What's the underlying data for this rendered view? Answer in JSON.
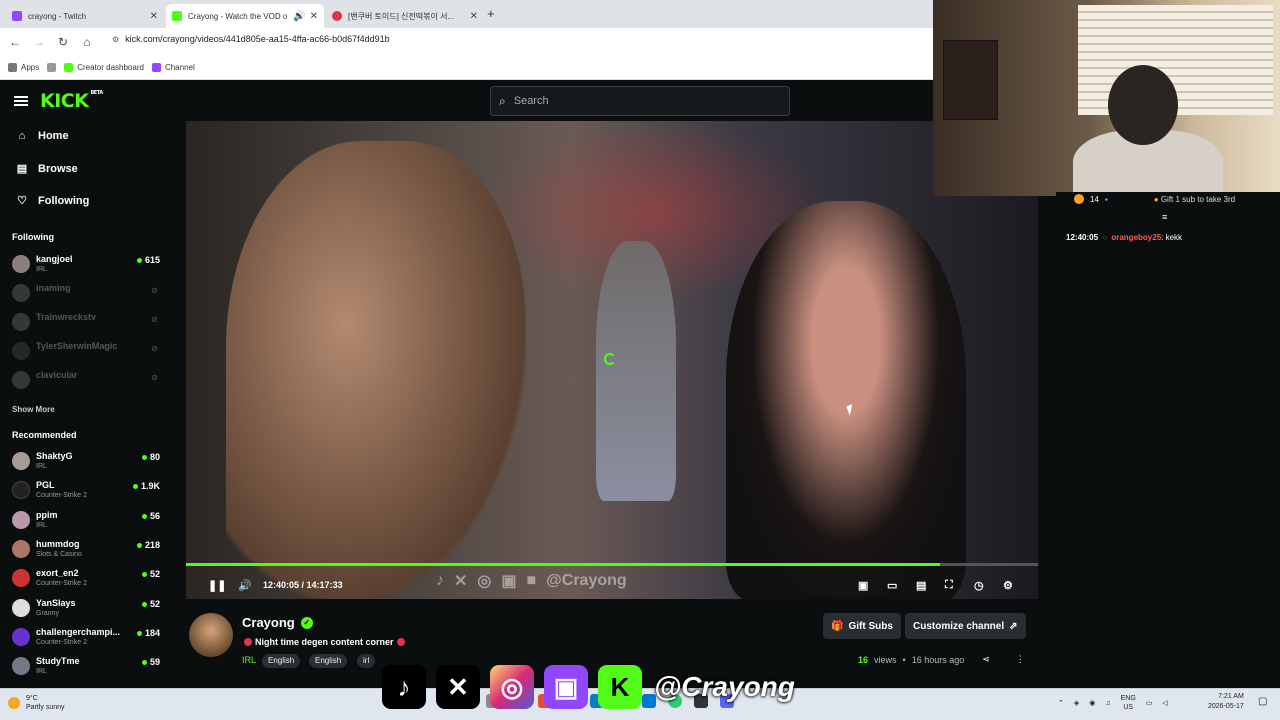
{
  "browser": {
    "tabs": [
      {
        "title": "crayong - Twitch",
        "color": "#9146ff",
        "active": false
      },
      {
        "title": "Crayong - Watch the VOD o",
        "color": "#53fc18",
        "active": true
      },
      {
        "title": "[밴쿠버 토이드] 신전떡볶이 서...",
        "color": "#e0344a",
        "active": false
      }
    ],
    "url": "kick.com/crayong/videos/441d805e-aa15-4ffa-ac66-b0d67f4dd91b",
    "bookmarks": [
      "Apps",
      "Creator dashboard",
      "Channel"
    ]
  },
  "kick": {
    "logo": "KICK",
    "logo_beta": "BETA",
    "search_placeholder": "Search",
    "nav": [
      {
        "label": "Home",
        "icon": "home-icon"
      },
      {
        "label": "Browse",
        "icon": "browse-icon"
      },
      {
        "label": "Following",
        "icon": "heart-icon"
      }
    ],
    "following_heading": "Following",
    "following": [
      {
        "name": "kangjoel",
        "category": "IRL",
        "viewers": "615",
        "online": true,
        "avatar": "#8a7f7a"
      },
      {
        "name": "inaming",
        "category": "",
        "viewers": "",
        "online": false,
        "avatar": "#888"
      },
      {
        "name": "Trainwreckstv",
        "category": "",
        "viewers": "",
        "online": false,
        "avatar": "#888"
      },
      {
        "name": "TylerSherwinMagic",
        "category": "",
        "viewers": "",
        "online": false,
        "avatar": "#555"
      },
      {
        "name": "clavicular",
        "category": "",
        "viewers": "",
        "online": false,
        "avatar": "#888"
      }
    ],
    "show_more": "Show More",
    "recommended_heading": "Recommended",
    "recommended": [
      {
        "name": "ShaktyG",
        "category": "IRL",
        "viewers": "80",
        "avatar": "#a99"
      },
      {
        "name": "PGL",
        "category": "Counter-Strike 2",
        "viewers": "1.9K",
        "avatar": "#222"
      },
      {
        "name": "ppim",
        "category": "IRL",
        "viewers": "56",
        "avatar": "#b9a"
      },
      {
        "name": "hummdog",
        "category": "Slots & Casino",
        "viewers": "218",
        "avatar": "#a76"
      },
      {
        "name": "exort_en2",
        "category": "Counter-Strike 2",
        "viewers": "52",
        "avatar": "#c33"
      },
      {
        "name": "YanSlays",
        "category": "Granny",
        "viewers": "52",
        "avatar": "#ddd"
      },
      {
        "name": "challengerchampi...",
        "category": "Counter-Strike 2",
        "viewers": "184",
        "avatar": "#63c"
      },
      {
        "name": "StudyTme",
        "category": "IRL",
        "viewers": "59",
        "avatar": "#778"
      }
    ],
    "player": {
      "current_time": "12:40:05",
      "duration": "14:17:33",
      "progress": 0.885,
      "watermark": "@Crayong"
    },
    "channel": {
      "name": "Crayong",
      "title": "Night time degen content corner",
      "category": "IRL",
      "tags": [
        "English",
        "English",
        "irl"
      ],
      "views_count": "16",
      "views_label": "views",
      "age": "16 hours ago",
      "gift_label": "Gift Subs",
      "customize_label": "Customize channel"
    },
    "chat": {
      "gift_count": "14",
      "gift_text": "Gift 1 sub to take 3rd",
      "messages": [
        {
          "time": "12:40:05",
          "user": "orangeboy25",
          "text": ": kekk",
          "color": "#ff5a5a"
        }
      ]
    }
  },
  "overlay": {
    "handle": "@Crayong",
    "socials": [
      "tiktok",
      "x",
      "instagram",
      "twitch",
      "kick"
    ]
  },
  "taskbar": {
    "temp": "9°C",
    "weather": "Partly sunny",
    "lang": "ENG",
    "region": "US",
    "time": "7:21 AM",
    "date": "2026-05-17"
  }
}
